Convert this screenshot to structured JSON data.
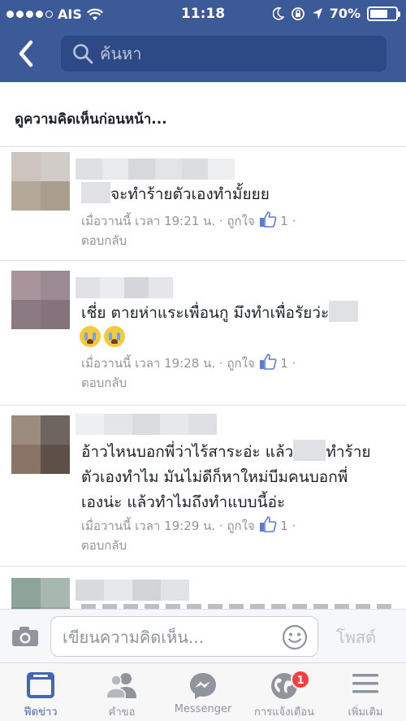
{
  "status_bar": {
    "carrier": "AIS",
    "time": "11:18",
    "battery": "70%",
    "battery_level": 0.7,
    "signal_bars": 4,
    "signal_total": 5
  },
  "nav": {
    "search_placeholder": "ค้นหา"
  },
  "feed": {
    "view_previous": "ดูความคิดเห็นก่อนหน้า...",
    "comments": [
      {
        "text": "จะทำร้ายตัวเองทำมั้ยยย",
        "time": "เมื่อวานนี้ เวลา 19:21 น.",
        "like": "ถูกใจ",
        "like_count": "1",
        "reply": "ตอบกลับ",
        "sep": "·"
      },
      {
        "text": "เชี่ย ตายห่าแระเพื่อนกู มึงทำเพื่อรัยว่ะ",
        "time": "เมื่อวานนี้ เวลา 19:28 น.",
        "like": "ถูกใจ",
        "like_count": "1",
        "reply": "ตอบกลับ",
        "sep": "·"
      },
      {
        "text_a": "อ้าวไหนบอกพี่ว่าไร้สาระอ่ะ  แล้ว",
        "text_b": "ทำร้าย",
        "text_c": "ตัวเองทำไม  มันไม่ดีก็หาใหม่บีมคนบอกพี่",
        "text_d": "เองน่ะ  แล้วทำไมถึงทำแบบนี้อ่ะ",
        "time": "เมื่อวานนี้ เวลา 19:29 น.",
        "like": "ถูกใจ",
        "like_count": "1",
        "reply": "ตอบกลับ",
        "sep": "·"
      }
    ]
  },
  "composer": {
    "placeholder": "เขียนความคิดเห็น...",
    "post_label": "โพสต์"
  },
  "tabs": [
    {
      "label": "ฟีดข่าว"
    },
    {
      "label": "คำขอ"
    },
    {
      "label": "Messenger"
    },
    {
      "label": "การแจ้งเตือน",
      "badge": "1"
    },
    {
      "label": "เพิ่มเติม"
    }
  ],
  "colors": {
    "nav_blue": "#3d5a98",
    "search_bg": "#2e4a86",
    "active_tab": "#4267b2",
    "badge_red": "#fa3e3e"
  }
}
